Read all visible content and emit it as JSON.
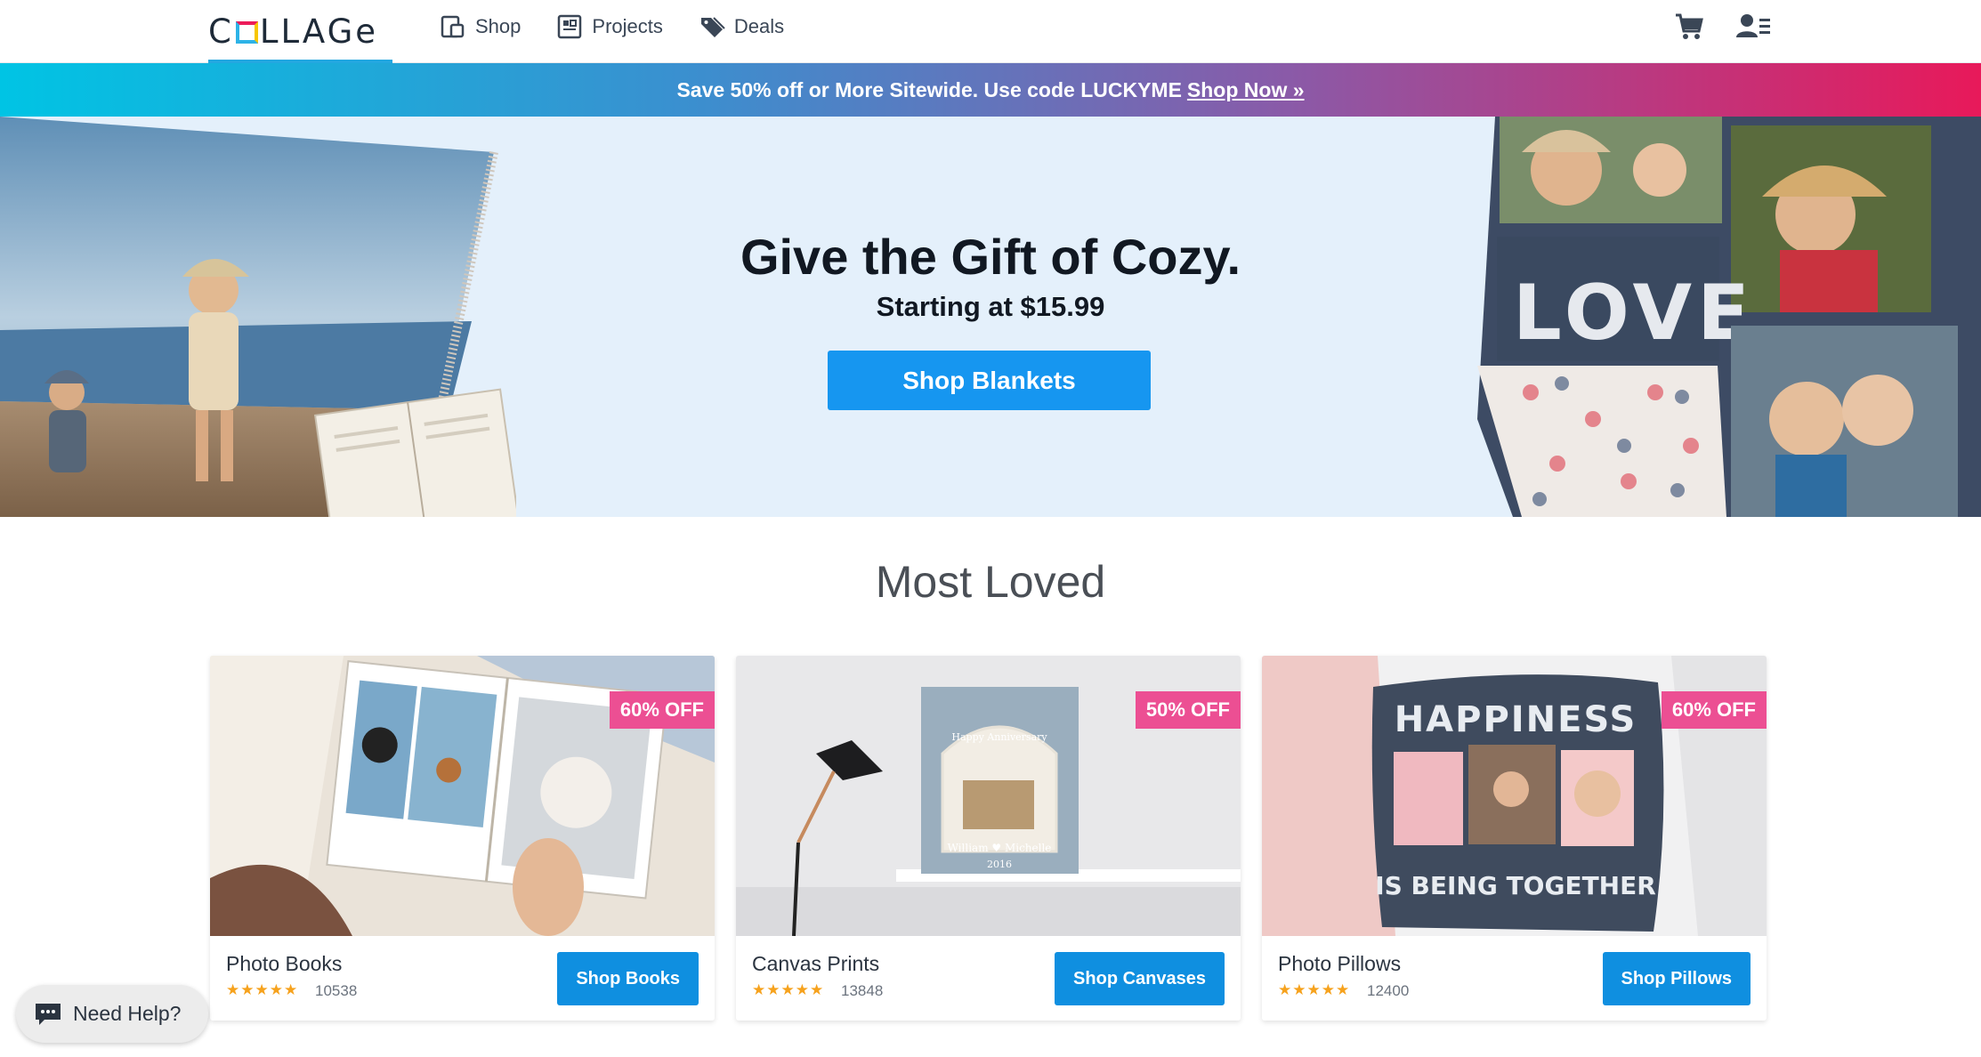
{
  "header": {
    "logo": "COLLAGE",
    "nav": [
      {
        "label": "Shop",
        "icon": "shop-icon"
      },
      {
        "label": "Projects",
        "icon": "projects-icon"
      },
      {
        "label": "Deals",
        "icon": "tag-icon"
      }
    ],
    "cart_icon": "cart-icon",
    "account_icon": "account-icon"
  },
  "promo": {
    "text": "Save 50% off or More Sitewide. Use code LUCKYME",
    "link": "Shop Now »"
  },
  "hero": {
    "title": "Give the Gift of Cozy.",
    "subtitle": "Starting at $15.99",
    "button": "Shop Blankets",
    "blanket_text": "LOVE"
  },
  "most_loved": {
    "title": "Most Loved",
    "cards": [
      {
        "name": "Photo Books",
        "badge": "60% OFF",
        "stars": "★★★★★",
        "rating": 5,
        "count": "10538",
        "button": "Shop Books"
      },
      {
        "name": "Canvas Prints",
        "badge": "50% OFF",
        "stars": "★★★★★",
        "rating": 5,
        "count": "13848",
        "button": "Shop Canvases",
        "canvas_text": {
          "line1": "Happy Anniversary",
          "names": "William  ♥  Michelle",
          "year": "2016"
        }
      },
      {
        "name": "Photo Pillows",
        "badge": "60% OFF",
        "stars": "★★★★★",
        "rating": 5,
        "count": "12400",
        "button": "Shop Pillows",
        "pillow_text": {
          "top": "HAPPINESS",
          "bottom": "IS BEING TOGETHER"
        }
      }
    ]
  },
  "help": {
    "label": "Need Help?",
    "icon": "chat-icon"
  },
  "colors": {
    "brand_blue": "#1696f0",
    "badge_pink": "#ec4f93",
    "hero_bg": "#e4f0fb"
  }
}
